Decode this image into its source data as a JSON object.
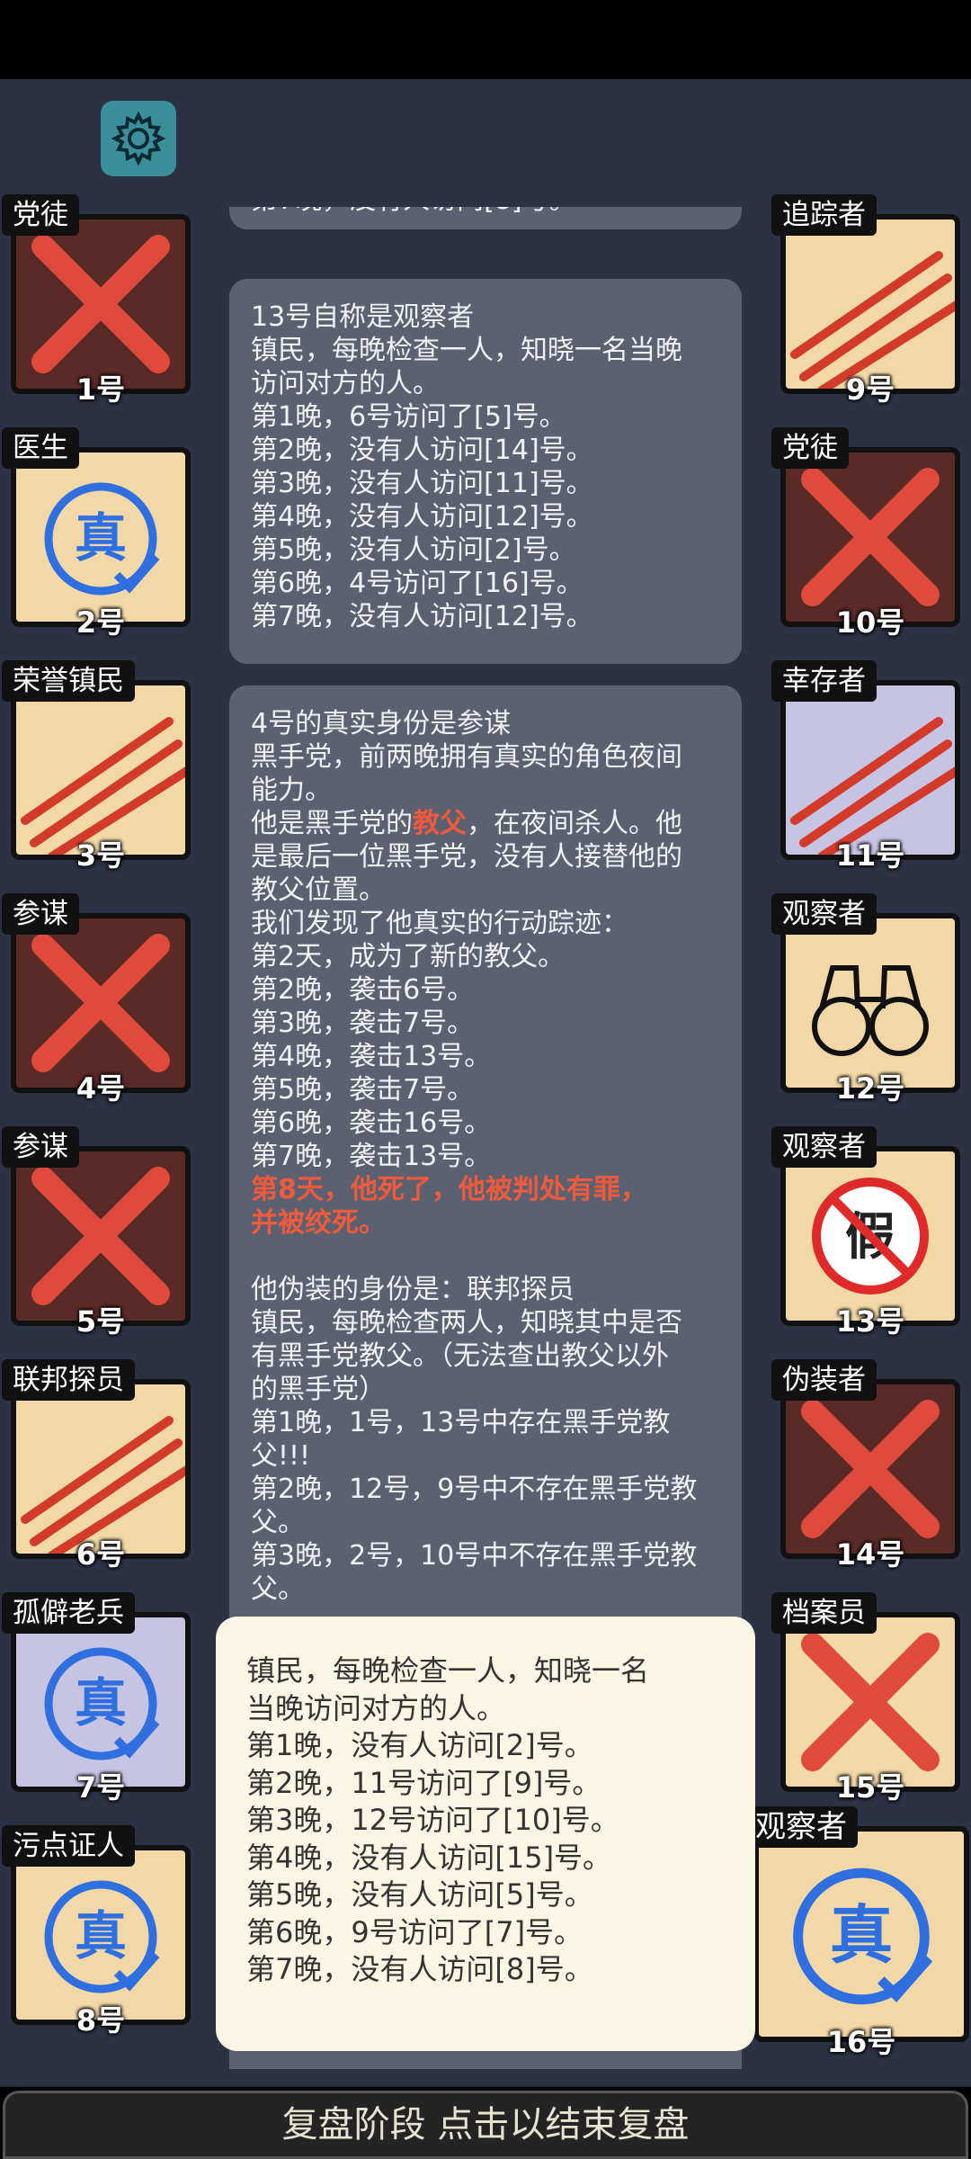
{
  "center_log": {
    "box_a": {
      "lines": [
        "第7晚，没有人访问[8]号。"
      ]
    },
    "box_b": {
      "lines": [
        "13号自称是观察者",
        "镇民，每晚检查一人，知晓一名当晚",
        "访问对方的人。",
        "第1晚，6号访问了[5]号。",
        "第2晚，没有人访问[14]号。",
        "第3晚，没有人访问[11]号。",
        "第4晚，没有人访问[12]号。",
        "第5晚，没有人访问[2]号。",
        "第6晚，4号访问了[16]号。",
        "第7晚，没有人访问[12]号。"
      ]
    },
    "box_c": {
      "line1": "4号的真实身份是参谋",
      "line2": "黑手党，前两晚拥有真实的角色夜间",
      "line3": "能力。",
      "line4_pre": "他是黑手党的",
      "line4_red": "教父",
      "line4_post": "，在夜间杀人。他",
      "line5": "是最后一位黑手党，没有人接替他的",
      "line6": "教父位置。",
      "line7": "我们发现了他真实的行动踪迹：",
      "line8": "第2天，成为了新的教父。",
      "line9": "第2晚，袭击6号。",
      "line10": "第3晚，袭击7号。",
      "line11": "第4晚，袭击13号。",
      "line12": "第5晚，袭击7号。",
      "line13": "第6晚，袭击16号。",
      "line14": "第7晚，袭击13号。",
      "death1": "第8天，他死了，他被判处有罪，",
      "death2": "并被绞死。",
      "line15": "他伪装的身份是：联邦探员",
      "line16": "镇民，每晚检查两人，知晓其中是否",
      "line17": "有黑手党教父。（无法查出教父以外",
      "line18": "的黑手党）",
      "line19": "第1晚，1号，13号中存在黑手党教",
      "line20": "父!!!",
      "line21": "第2晚，12号，9号中不存在黑手党教",
      "line22": "父。",
      "line23": "第3晚，2号，10号中不存在黑手党教",
      "line24": "父。"
    }
  },
  "popup": {
    "lines": [
      "镇民，每晚检查一人，知晓一名",
      "当晚访问对方的人。",
      "第1晚，没有人访问[2]号。",
      "第2晚，11号访问了[9]号。",
      "第3晚，12号访问了[10]号。",
      "第4晚，没有人访问[15]号。",
      "第5晚，没有人访问[5]号。",
      "第6晚，9号访问了[7]号。",
      "第7晚，没有人访问[8]号。"
    ]
  },
  "players": {
    "p1": {
      "role": "党徒",
      "num": "1号",
      "state": "eliminated-x"
    },
    "p2": {
      "role": "医生",
      "num": "2号",
      "state": "verified",
      "stamp": "真"
    },
    "p3": {
      "role": "荣誉镇民",
      "num": "3号",
      "state": "killed-claw"
    },
    "p4": {
      "role": "参谋",
      "num": "4号",
      "state": "eliminated-x"
    },
    "p5": {
      "role": "参谋",
      "num": "5号",
      "state": "eliminated-x"
    },
    "p6": {
      "role": "联邦探员",
      "num": "6号",
      "state": "killed-claw"
    },
    "p7": {
      "role": "孤僻老兵",
      "num": "7号",
      "state": "verified",
      "stamp": "真"
    },
    "p8": {
      "role": "污点证人",
      "num": "8号",
      "state": "verified",
      "stamp": "真"
    },
    "p9": {
      "role": "追踪者",
      "num": "9号",
      "state": "killed-claw"
    },
    "p10": {
      "role": "党徒",
      "num": "10号",
      "state": "eliminated-x"
    },
    "p11": {
      "role": "幸存者",
      "num": "11号",
      "state": "killed-claw"
    },
    "p12": {
      "role": "观察者",
      "num": "12号",
      "state": "alive"
    },
    "p13": {
      "role": "观察者",
      "num": "13号",
      "state": "fake",
      "stamp": "假"
    },
    "p14": {
      "role": "伪装者",
      "num": "14号",
      "state": "eliminated-x"
    },
    "p15": {
      "role": "档案员",
      "num": "15号",
      "state": "eliminated-x"
    },
    "p16": {
      "role": "观察者",
      "num": "16号",
      "state": "verified",
      "stamp": "真"
    }
  },
  "end_button": {
    "label": "复盘阶段 点击以结束复盘"
  },
  "colors": {
    "accent_red": "#ef5a3c",
    "stamp_blue": "#2f6fe0",
    "x_red": "#e04a3c"
  }
}
